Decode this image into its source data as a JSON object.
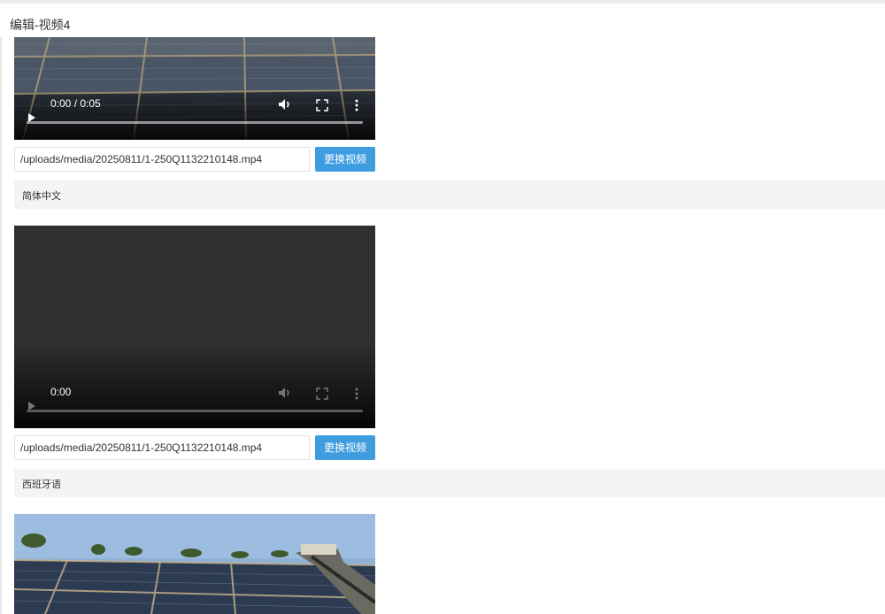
{
  "page": {
    "title": "编辑-视频4"
  },
  "videos": [
    {
      "time": "0:00 / 0:05",
      "path": "/uploads/media/20250811/1-250Q1132210148.mp4",
      "button": "更换视频"
    },
    {
      "time": "0:00",
      "path": "/uploads/media/20250811/1-250Q1132210148.mp4",
      "button": "更换视频"
    }
  ],
  "languages": [
    "简体中文",
    "西班牙语"
  ],
  "icons": [
    "play-icon",
    "volume-icon",
    "fullscreen-icon",
    "more-options-icon"
  ],
  "colors": {
    "accent": "#3f9ddf",
    "section_bg": "#f4f4f4"
  }
}
